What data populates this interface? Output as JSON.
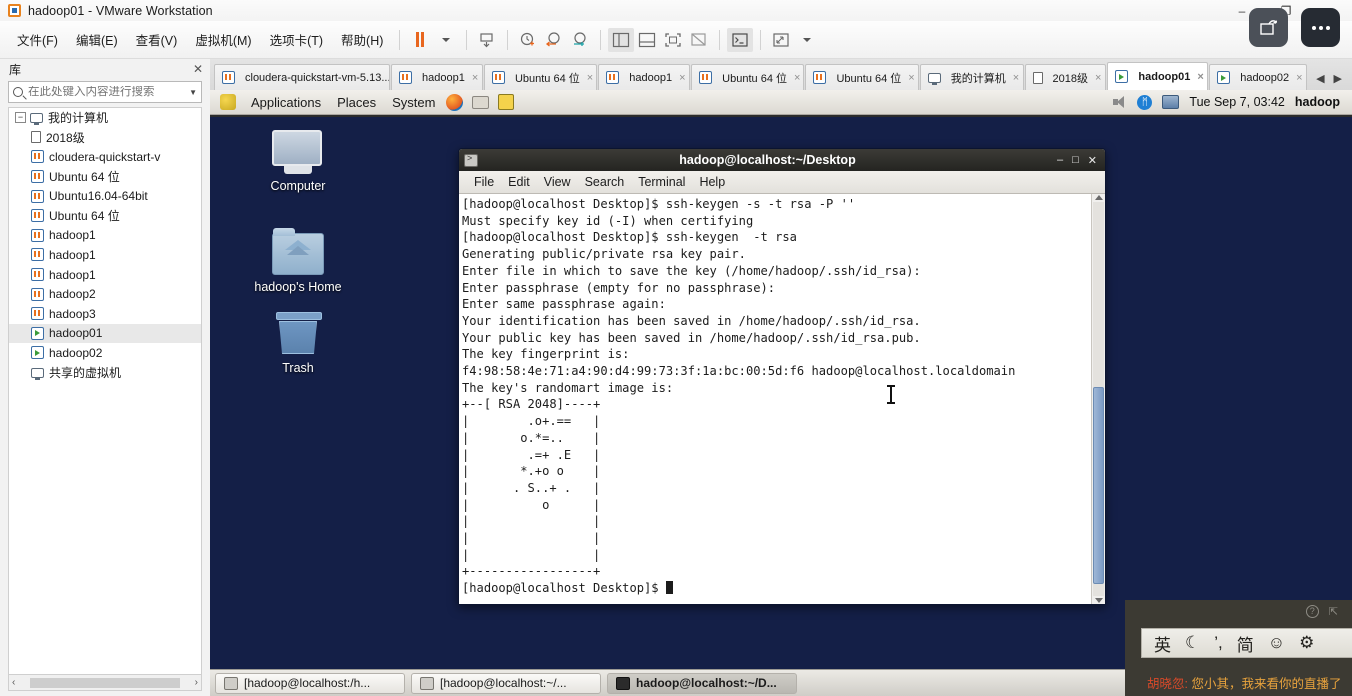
{
  "window": {
    "title": "hadoop01 - VMware Workstation",
    "minimize": "–",
    "maximize": "❐",
    "close": "×"
  },
  "menubar": {
    "items": [
      {
        "label": "文件(F)",
        "name": "menu-file"
      },
      {
        "label": "编辑(E)",
        "name": "menu-edit"
      },
      {
        "label": "查看(V)",
        "name": "menu-view"
      },
      {
        "label": "虚拟机(M)",
        "name": "menu-vm"
      },
      {
        "label": "选项卡(T)",
        "name": "menu-tabs"
      },
      {
        "label": "帮助(H)",
        "name": "menu-help"
      }
    ]
  },
  "library": {
    "header": "库",
    "close": "✕",
    "search_placeholder": "在此处键入内容进行搜索",
    "search_value": "",
    "dropdown_caret": "▼",
    "scroll_left": "‹",
    "scroll_right": "›",
    "tree": [
      {
        "label": "我的计算机",
        "icon": "monitor",
        "level": 0,
        "expander": "−",
        "selected": false
      },
      {
        "label": "2018级",
        "icon": "folder-doc",
        "level": 1,
        "expander": "",
        "selected": false
      },
      {
        "label": "cloudera-quickstart-v",
        "icon": "vm",
        "level": 1,
        "expander": "",
        "selected": false
      },
      {
        "label": "Ubuntu 64 位",
        "icon": "vm",
        "level": 1,
        "expander": "",
        "selected": false
      },
      {
        "label": "Ubuntu16.04-64bit",
        "icon": "vm",
        "level": 1,
        "expander": "",
        "selected": false
      },
      {
        "label": "Ubuntu 64 位",
        "icon": "vm",
        "level": 1,
        "expander": "",
        "selected": false
      },
      {
        "label": "hadoop1",
        "icon": "vm",
        "level": 1,
        "expander": "",
        "selected": false
      },
      {
        "label": "hadoop1",
        "icon": "vm",
        "level": 1,
        "expander": "",
        "selected": false
      },
      {
        "label": "hadoop1",
        "icon": "vm",
        "level": 1,
        "expander": "",
        "selected": false
      },
      {
        "label": "hadoop2",
        "icon": "vm",
        "level": 1,
        "expander": "",
        "selected": false
      },
      {
        "label": "hadoop3",
        "icon": "vm",
        "level": 1,
        "expander": "",
        "selected": false
      },
      {
        "label": "hadoop01",
        "icon": "vmrun",
        "level": 1,
        "expander": "",
        "selected": true
      },
      {
        "label": "hadoop02",
        "icon": "vmrun",
        "level": 1,
        "expander": "",
        "selected": false
      },
      {
        "label": "共享的虚拟机",
        "icon": "monitor",
        "level": 0,
        "expander": "",
        "selected": false
      }
    ]
  },
  "tabstrip": {
    "tabs": [
      {
        "label": "cloudera-quickstart-vm-5.13....",
        "icon": "vm",
        "active": false
      },
      {
        "label": "hadoop1",
        "icon": "vm",
        "active": false
      },
      {
        "label": "Ubuntu 64 位",
        "icon": "vm",
        "active": false
      },
      {
        "label": "hadoop1",
        "icon": "vm",
        "active": false
      },
      {
        "label": "Ubuntu 64 位",
        "icon": "vm",
        "active": false
      },
      {
        "label": "Ubuntu 64 位",
        "icon": "vm",
        "active": false
      },
      {
        "label": "我的计算机",
        "icon": "monitor",
        "active": false
      },
      {
        "label": "2018级",
        "icon": "folder-doc",
        "active": false
      },
      {
        "label": "hadoop01",
        "icon": "vmrun",
        "active": true
      },
      {
        "label": "hadoop02",
        "icon": "vmrun",
        "active": false
      }
    ],
    "close_glyph": "×",
    "nav_prev": "◀",
    "nav_next": "▶"
  },
  "gnome_panel": {
    "menus": [
      "Applications",
      "Places",
      "System"
    ],
    "clock": "Tue Sep  7, 03:42",
    "user": "hadoop",
    "bluetooth_glyph": "ᛗ"
  },
  "desktop": {
    "icons": [
      {
        "label": "Computer",
        "kind": "computer"
      },
      {
        "label": "hadoop's Home",
        "kind": "home"
      },
      {
        "label": "Trash",
        "kind": "trash"
      }
    ]
  },
  "terminal": {
    "title": "hadoop@localhost:~/Desktop",
    "minimize": "–",
    "maximize": "□",
    "close": "✕",
    "menus": [
      "File",
      "Edit",
      "View",
      "Search",
      "Terminal",
      "Help"
    ],
    "lines": [
      "[hadoop@localhost Desktop]$ ssh-keygen -s -t rsa -P ''",
      "Must specify key id (-I) when certifying",
      "[hadoop@localhost Desktop]$ ssh-keygen  -t rsa",
      "Generating public/private rsa key pair.",
      "Enter file in which to save the key (/home/hadoop/.ssh/id_rsa):",
      "Enter passphrase (empty for no passphrase):",
      "Enter same passphrase again:",
      "Your identification has been saved in /home/hadoop/.ssh/id_rsa.",
      "Your public key has been saved in /home/hadoop/.ssh/id_rsa.pub.",
      "The key fingerprint is:",
      "f4:98:58:4e:71:a4:90:d4:99:73:3f:1a:bc:00:5d:f6 hadoop@localhost.localdomain",
      "The key's randomart image is:",
      "+--[ RSA 2048]----+",
      "|        .o+.==   |",
      "|       o.*=..    |",
      "|        .=+ .E   |",
      "|       *.+o o    |",
      "|      . S..+ .   |",
      "|          o      |",
      "|                 |",
      "|                 |",
      "|                 |",
      "+-----------------+"
    ],
    "prompt": "[hadoop@localhost Desktop]$ "
  },
  "gnome_taskbar": {
    "buttons": [
      {
        "label": "[hadoop@localhost:/h...",
        "active": false
      },
      {
        "label": "[hadoop@localhost:~/...",
        "active": false
      },
      {
        "label": "hadoop@localhost:~/D...",
        "active": true
      }
    ]
  },
  "ime": {
    "help_glyph": "?",
    "pin_glyph": "⇱",
    "items": [
      "英",
      "☾",
      "’,",
      "简",
      "☺",
      "⚙"
    ],
    "subtitle_left": "胡晓忽:",
    "subtitle_right": "您小其，我来看你的直播了"
  },
  "colors": {
    "desktop_bg": "#141f47",
    "accent_orange": "#e8701e",
    "terminal_bg": "#ffffff",
    "scrollbar_thumb": "#7b9ac4"
  }
}
